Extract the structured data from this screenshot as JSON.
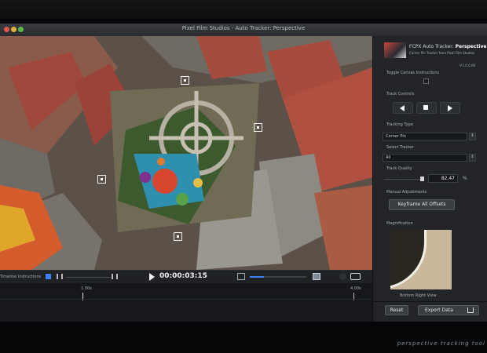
{
  "window": {
    "title": "Pixel Film Studios - Auto Tracker: Perspective"
  },
  "panel": {
    "header_title_plain": "FCPX Auto Tracker:",
    "header_title_bold": "Perspective",
    "header_subtitle": "Corner Pin Tracker from Pixel Film Studios",
    "version": "V.1.0.0.00",
    "toggle_canvas_label": "Toggle Canvas Instructions",
    "track_controls_label": "Track Controls",
    "tracking_type_label": "Tracking Type",
    "tracking_type_value": "Corner Pin",
    "select_tracker_label": "Select Tracker",
    "select_tracker_value": "All",
    "track_quality_label": "Track Quality",
    "track_quality_value": "82.47",
    "track_quality_unit": "%",
    "manual_adjustments_label": "Manual Adjustments",
    "keyframe_button": "Keyframe All Offsets",
    "magnification_label": "Magnification",
    "magnification_caption": "Bottom Right View",
    "reset_button": "Reset",
    "export_button": "Export Data"
  },
  "transport": {
    "instructions_label": "Timeline Instructions",
    "timecode": "00:00:03:15"
  },
  "timeline": {
    "marker_start": "1.00s",
    "marker_end": "4.00s"
  },
  "icons": {
    "play": "play-icon",
    "export": "export-icon",
    "camera": "camera-icon"
  },
  "overlay": {
    "caption": "perspective tracking tool"
  },
  "colors": {
    "accent": "#3b82f6",
    "playhead": "#ffffff"
  }
}
